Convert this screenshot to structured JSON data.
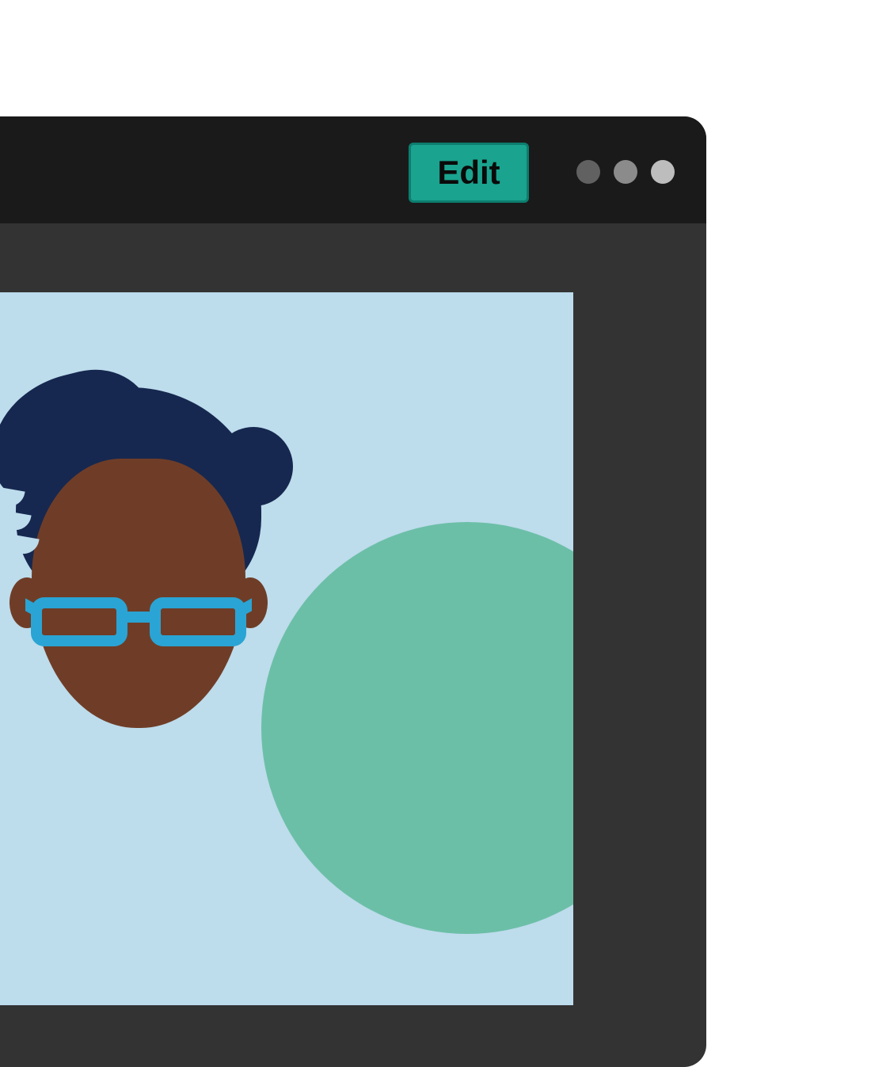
{
  "header": {
    "edit_label": "Edit"
  },
  "colors": {
    "window_bg": "#333333",
    "titlebar_bg": "#1a1a1a",
    "accent": "#1aa38f",
    "canvas_bg": "#bddcec",
    "blob": "#6cbfa7",
    "hair_navy": "#162850",
    "skin_dark": "#6f3d27",
    "skin_light": "#f7d0b6",
    "glasses": "#2aa4d4"
  }
}
